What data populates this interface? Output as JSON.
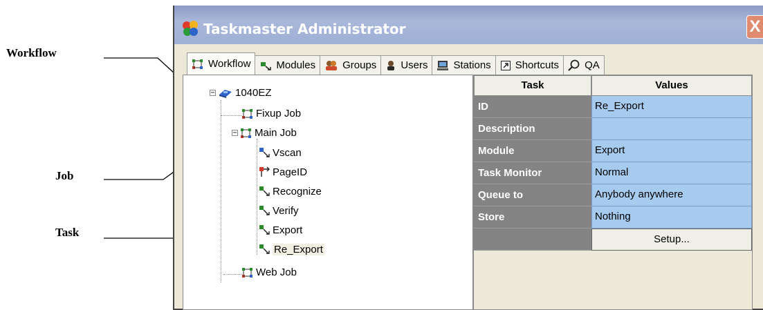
{
  "callouts": {
    "workflow": "Workflow",
    "job": "Job",
    "task": "Task"
  },
  "window": {
    "title": "Taskmaster Administrator",
    "close_glyph": "X"
  },
  "tabs": [
    {
      "label": "Workflow",
      "icon": "workflow-icon",
      "active": true
    },
    {
      "label": "Modules",
      "icon": "module-icon"
    },
    {
      "label": "Groups",
      "icon": "groups-icon"
    },
    {
      "label": "Users",
      "icon": "user-icon"
    },
    {
      "label": "Stations",
      "icon": "station-icon"
    },
    {
      "label": "Shortcuts",
      "icon": "shortcut-icon"
    },
    {
      "label": "QA",
      "icon": "magnifier-icon"
    }
  ],
  "tree": {
    "root": "1040EZ",
    "jobs": {
      "fixup": "Fixup Job",
      "main": "Main Job",
      "web": "Web Job"
    },
    "tasks": [
      "Vscan",
      "PageID",
      "Recognize",
      "Verify",
      "Export",
      "Re_Export"
    ],
    "selected": "Re_Export"
  },
  "grid": {
    "header_key": "Task",
    "header_value": "Values",
    "rows": [
      {
        "key": "ID",
        "value": "Re_Export"
      },
      {
        "key": "Description",
        "value": ""
      },
      {
        "key": "Module",
        "value": "Export"
      },
      {
        "key": "Task Monitor",
        "value": "Normal"
      },
      {
        "key": "Queue to",
        "value": "Anybody anywhere"
      },
      {
        "key": "Store",
        "value": "Nothing"
      }
    ],
    "setup_label": "Setup..."
  },
  "colors": {
    "titlebar": "#9fb0d6",
    "grid_key_bg": "#848484",
    "grid_value_bg": "#a6cbee"
  }
}
